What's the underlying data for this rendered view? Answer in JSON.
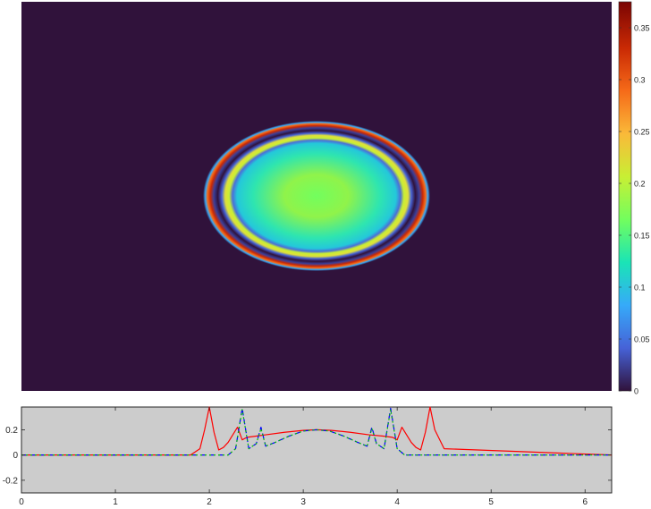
{
  "chart_data": [
    {
      "type": "heatmap",
      "title": "",
      "xlabel": "",
      "ylabel": "",
      "axes_visible": false,
      "background_value": 0,
      "field": {
        "shape": "concentric elliptical rings",
        "center_value": 0.2,
        "inner_plateau_edge_value": 0.13,
        "ring_values": [
          0.24,
          0.37
        ],
        "outside_value": 0
      },
      "colormap": "turbo",
      "colorbar": {
        "range": [
          0,
          0.375
        ],
        "ticks": [
          0,
          0.05,
          0.1,
          0.15,
          0.2,
          0.25,
          0.3,
          0.35
        ],
        "tick_labels": [
          "0",
          "0.05",
          "0.1",
          "0.15",
          "0.2",
          "0.25",
          "0.3",
          "0.35"
        ],
        "colors": [
          "#30123b",
          "#4662d7",
          "#36aaf9",
          "#1ae4b6",
          "#72fe5e",
          "#c8ef34",
          "#faba39",
          "#f66b19",
          "#ca2a04",
          "#7a0403"
        ]
      }
    },
    {
      "type": "line",
      "title": "",
      "xlabel": "",
      "ylabel": "",
      "xlim": [
        0,
        6.2832
      ],
      "ylim": [
        -0.3,
        0.38
      ],
      "xticks": [
        0,
        1,
        2,
        3,
        4,
        5,
        6
      ],
      "xtick_labels": [
        "0",
        "1",
        "2",
        "3",
        "4",
        "5",
        "6"
      ],
      "yticks": [
        -0.2,
        0,
        0.2
      ],
      "ytick_labels": [
        "-0.2",
        "0",
        "0.2"
      ],
      "grid": false,
      "background": "#cccccc",
      "series": [
        {
          "color": "#ff0000",
          "style": "solid",
          "x": [
            0,
            1.8,
            1.9,
            1.95,
            2.0,
            2.05,
            2.1,
            2.15,
            2.2,
            2.25,
            2.3,
            2.35,
            2.4,
            2.5,
            2.6,
            2.8,
            3.0,
            3.14,
            3.3,
            3.5,
            3.7,
            3.85,
            3.95,
            4.0,
            4.05,
            4.1,
            4.15,
            4.2,
            4.25,
            4.3,
            4.35,
            4.4,
            4.5,
            6.2832
          ],
          "y": [
            0,
            0,
            0.05,
            0.2,
            0.38,
            0.18,
            0.04,
            0.06,
            0.1,
            0.16,
            0.22,
            0.12,
            0.14,
            0.15,
            0.16,
            0.18,
            0.195,
            0.2,
            0.195,
            0.18,
            0.16,
            0.15,
            0.14,
            0.12,
            0.22,
            0.16,
            0.1,
            0.06,
            0.04,
            0.18,
            0.38,
            0.2,
            0.05,
            0
          ]
        },
        {
          "color": "#0000ff",
          "style": "dashed",
          "x": [
            0,
            2.2,
            2.28,
            2.35,
            2.42,
            2.5,
            2.55,
            2.6,
            2.7,
            2.85,
            3.0,
            3.14,
            3.28,
            3.43,
            3.58,
            3.68,
            3.73,
            3.78,
            3.86,
            3.93,
            4.0,
            4.08,
            6.2832
          ],
          "y": [
            0,
            0,
            0.05,
            0.37,
            0.05,
            0.09,
            0.22,
            0.07,
            0.1,
            0.15,
            0.19,
            0.2,
            0.19,
            0.15,
            0.1,
            0.07,
            0.22,
            0.09,
            0.05,
            0.37,
            0.05,
            0,
            0
          ]
        },
        {
          "color": "#00c000",
          "style": "dotted",
          "x": [
            0,
            2.2,
            2.28,
            2.35,
            2.42,
            2.5,
            2.55,
            2.6,
            2.7,
            2.85,
            3.0,
            3.14,
            3.28,
            3.43,
            3.58,
            3.68,
            3.73,
            3.78,
            3.86,
            3.93,
            4.0,
            4.08,
            6.2832
          ],
          "y": [
            0,
            0,
            0.05,
            0.36,
            0.05,
            0.09,
            0.21,
            0.07,
            0.1,
            0.15,
            0.19,
            0.2,
            0.19,
            0.15,
            0.1,
            0.07,
            0.21,
            0.09,
            0.05,
            0.36,
            0.05,
            0,
            0
          ]
        }
      ]
    }
  ]
}
